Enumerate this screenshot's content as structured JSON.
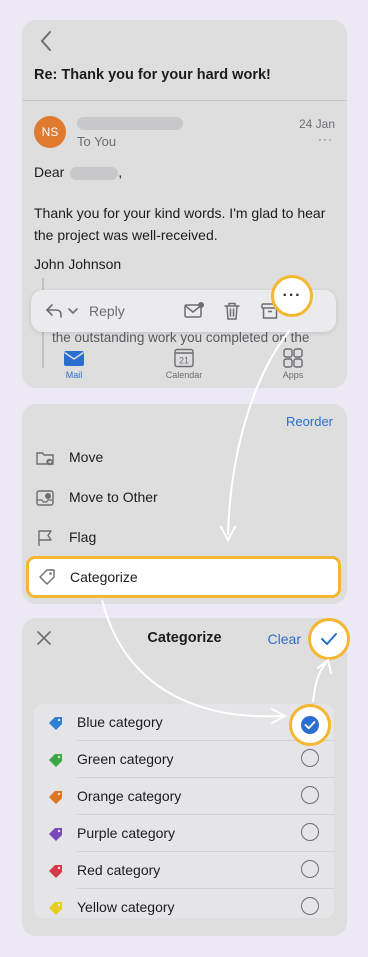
{
  "email": {
    "subject": "Re: Thank you for your hard work!",
    "avatar_initials": "NS",
    "to_label": "To You",
    "date": "24 Jan",
    "more_label": "···",
    "greeting": "Dear",
    "greeting_suffix": ",",
    "body_line1": "Thank you for your kind words. I'm glad to hear",
    "body_line2": "the project was well-received.",
    "signature": "John Johnson",
    "quote_line2": "the outstanding work you completed on the"
  },
  "toolbar": {
    "reply_label": "Reply",
    "more_button": "···"
  },
  "tabs": [
    {
      "label": "Mail",
      "icon": "mail-icon",
      "active": true
    },
    {
      "label": "Calendar",
      "icon": "calendar-icon",
      "calendar_day": "21"
    },
    {
      "label": "Apps",
      "icon": "apps-icon"
    }
  ],
  "actions": {
    "reorder_label": "Reorder",
    "items": [
      {
        "label": "Move",
        "icon": "folder-move-icon"
      },
      {
        "label": "Move to Other",
        "icon": "move-to-other-icon"
      },
      {
        "label": "Flag",
        "icon": "flag-icon"
      },
      {
        "label": "Categorize",
        "icon": "tag-icon",
        "highlighted": true
      }
    ]
  },
  "categorize": {
    "title": "Categorize",
    "clear_label": "Clear",
    "categories": [
      {
        "label": "Blue category",
        "color": "#2f7fd6",
        "selected": true
      },
      {
        "label": "Green category",
        "color": "#3aa845",
        "selected": false
      },
      {
        "label": "Orange category",
        "color": "#e2761e",
        "selected": false
      },
      {
        "label": "Purple category",
        "color": "#7a4bb8",
        "selected": false
      },
      {
        "label": "Red category",
        "color": "#d63a4a",
        "selected": false
      },
      {
        "label": "Yellow category",
        "color": "#e6cf1e",
        "selected": false
      }
    ]
  },
  "colors": {
    "accent": "#2b6ecf",
    "highlight": "#f5b630",
    "avatar": "#e07a2f"
  }
}
